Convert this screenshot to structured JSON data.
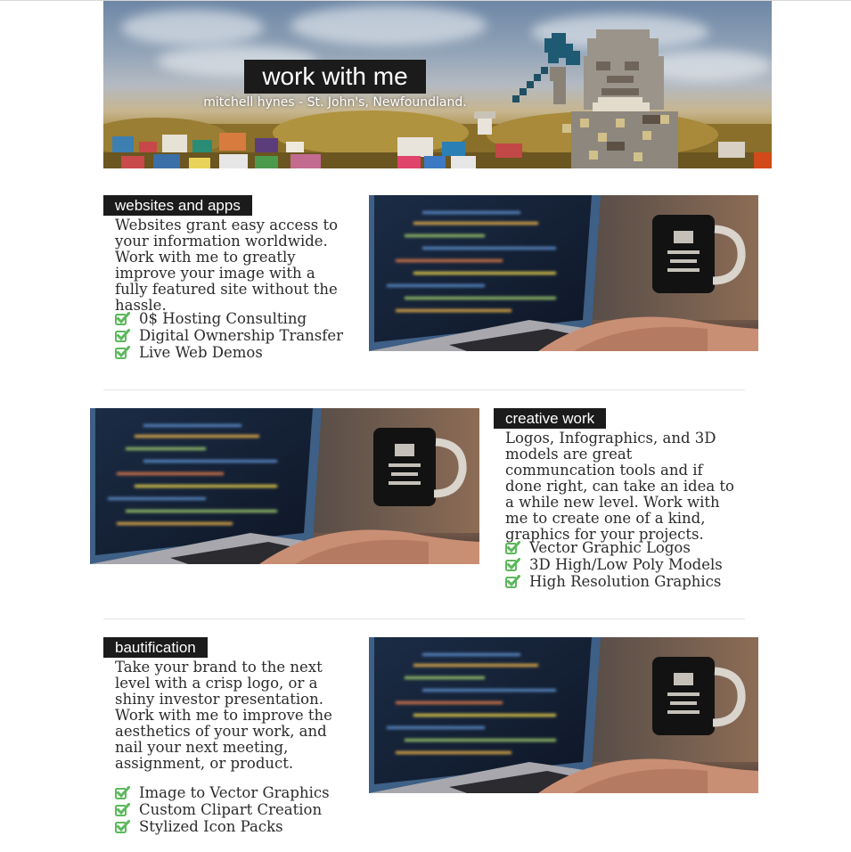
{
  "hero": {
    "title": "work with me",
    "subtitle": "mitchell hynes - St. John's, Newfoundland."
  },
  "sections": [
    {
      "tag": "websites and apps",
      "description": "Websites grant easy access to your information worldwide. Work with me to greatly improve your image with a fully featured site without the hassle.",
      "features": [
        "0$ Hosting Consulting",
        "Digital Ownership Transfer",
        "Live Web Demos"
      ]
    },
    {
      "tag": "creative work",
      "description": "Logos, Infographics, and 3D models are great communcation tools and if done right, can take an idea to a while new level. Work with me to create one of a kind, graphics for your projects.",
      "features": [
        "Vector Graphic Logos",
        "3D High/Low Poly Models",
        "High Resolution Graphics"
      ]
    },
    {
      "tag": "bautification",
      "description": "Take your brand to the next level with a crisp logo, or a shiny investor presentation. Work with me to improve the aesthetics of your work, and nail your next meeting, assignment, or product.",
      "features": [
        "Image to Vector Graphics",
        "Custom Clipart Creation",
        "Stylized Icon Packs"
      ]
    }
  ],
  "colors": {
    "tag_background": "#1b1b1b",
    "check_green": "#5cb85c",
    "divider": "#e6e6e6"
  },
  "icons": {
    "feature_bullet": "check-square-icon",
    "hero_character": "pixel-hammer-character"
  }
}
